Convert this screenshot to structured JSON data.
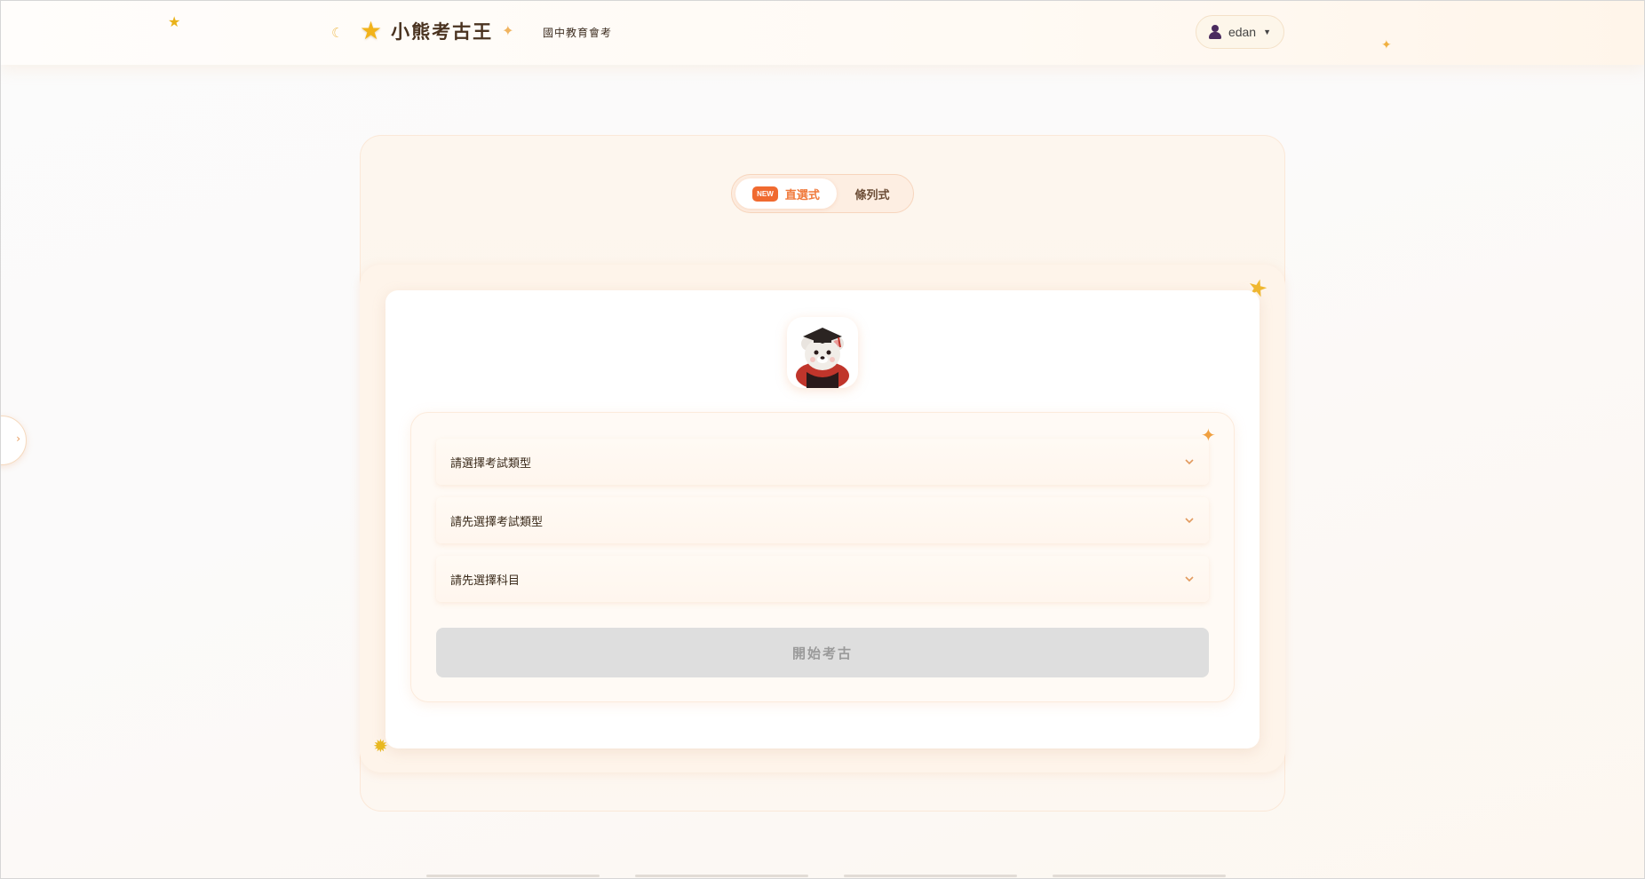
{
  "header": {
    "title": "小熊考古王",
    "subtitle": "國中教育會考",
    "user": {
      "name": "edan"
    }
  },
  "mode_toggle": {
    "badge": "NEW",
    "tabs": [
      {
        "label": "直選式",
        "active": true
      },
      {
        "label": "條列式",
        "active": false
      }
    ]
  },
  "form": {
    "exam_type": {
      "value": "請選擇考試類型"
    },
    "exam": {
      "value": "請先選擇考試類型"
    },
    "subject": {
      "value": "請先選擇科目"
    },
    "start_label": "開始考古"
  },
  "colors": {
    "accent": "#f07a3c",
    "star": "#f2b31a",
    "disabled_button": "#dedede"
  }
}
